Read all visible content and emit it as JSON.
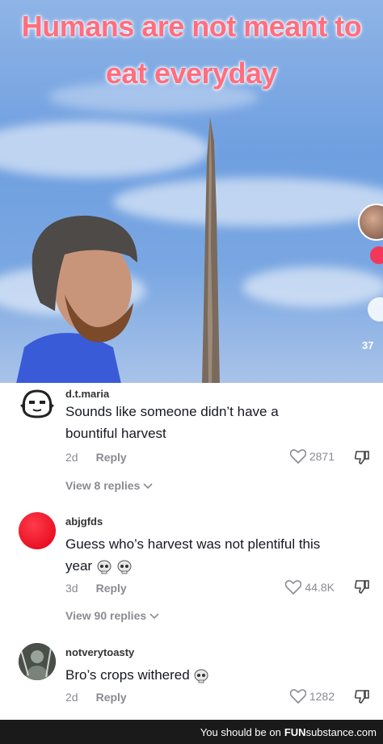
{
  "caption": {
    "line1": "Humans are not meant to",
    "line2": "eat everyday"
  },
  "video": {
    "side_like_count": "37"
  },
  "comments": [
    {
      "username": "d.t.maria",
      "text": "Sounds like someone didn’t have a bountiful harvest",
      "age": "2d",
      "reply_label": "Reply",
      "likes": "2871",
      "view_replies": "View 8 replies"
    },
    {
      "username": "abjgfds",
      "text_line1": "Guess who’s harvest was not plentiful this",
      "text_line2": "year",
      "age": "3d",
      "reply_label": "Reply",
      "likes": "44.8K",
      "view_replies": "View 90 replies"
    },
    {
      "username": "notverytoasty",
      "text": "Bro’s crops withered",
      "age": "2d",
      "reply_label": "Reply",
      "likes": "1282"
    }
  ],
  "footer": {
    "prefix": "You should be on",
    "brand_fun": "FUN",
    "brand_rest": "substance.com"
  },
  "colors": {
    "caption": "#ff6e7f",
    "red_avatar": "#ff1a2e",
    "footer_bg": "#1a1a1a"
  },
  "icons": [
    "heart-outline-icon",
    "dislike-icon",
    "chevron-down-icon",
    "skull-emoji-icon"
  ]
}
